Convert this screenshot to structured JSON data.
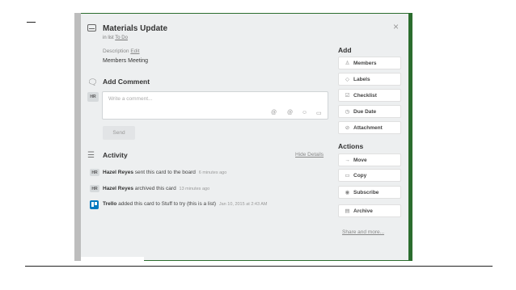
{
  "card": {
    "title": "Materials Update",
    "in_list_prefix": "in list",
    "list_name": "To Do",
    "close_glyph": "×",
    "description_label": "Description",
    "edit_link": "Edit",
    "description_text": "Members Meeting"
  },
  "comment": {
    "heading": "Add Comment",
    "avatar_initials": "HR",
    "placeholder": "Write a comment...",
    "attach_icons": [
      "@",
      "@",
      "☺",
      "▭"
    ],
    "send_label": "Send"
  },
  "activity": {
    "heading": "Activity",
    "hide_details": "Hide Details",
    "items": [
      {
        "avatar": "HR",
        "user": "Hazel Reyes",
        "text": "sent this card to the board",
        "time": "6 minutes ago"
      },
      {
        "avatar": "HR",
        "user": "Hazel Reyes",
        "text": "archived this card",
        "time": "13 minutes ago"
      },
      {
        "avatar": "",
        "user": "Trello",
        "text": "added this card to Stuff to try (this is a list)",
        "time": "Jan 10, 2015 at 2:43 AM"
      }
    ]
  },
  "sidebar": {
    "add_heading": "Add",
    "add_buttons": [
      {
        "icon": "person-icon",
        "glyph": "♙",
        "label": "Members"
      },
      {
        "icon": "label-icon",
        "glyph": "◇",
        "label": "Labels"
      },
      {
        "icon": "checklist-icon",
        "glyph": "☑",
        "label": "Checklist"
      },
      {
        "icon": "clock-icon",
        "glyph": "◷",
        "label": "Due Date"
      },
      {
        "icon": "paperclip-icon",
        "glyph": "⊘",
        "label": "Attachment"
      }
    ],
    "actions_heading": "Actions",
    "action_buttons": [
      {
        "icon": "arrow-right-icon",
        "glyph": "→",
        "label": "Move"
      },
      {
        "icon": "copy-icon",
        "glyph": "▭",
        "label": "Copy"
      },
      {
        "icon": "eye-icon",
        "glyph": "◉",
        "label": "Subscribe"
      },
      {
        "icon": "archive-icon",
        "glyph": "▤",
        "label": "Archive"
      }
    ],
    "share_link": "Share and more..."
  },
  "colors": {
    "board_background": "#2e7431",
    "card_background": "#edeff0",
    "trello_blue": "#0079bf"
  }
}
